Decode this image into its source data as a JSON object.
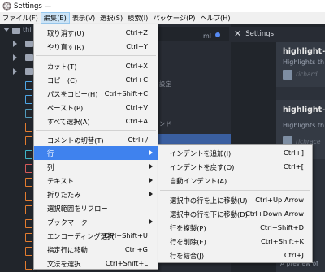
{
  "window": {
    "title": "Settings — "
  },
  "menubar": [
    "ファイル(F)",
    "編集(E)",
    "表示(V)",
    "選択(S)",
    "検索(I)",
    "パッケージ(P)",
    "ヘルプ(H)"
  ],
  "tree": {
    "root_label": "thi"
  },
  "background": {
    "tab_fragment": "ml",
    "settings_tab_label": "Settings",
    "settings_fragment_1": "設定",
    "settings_fragment_2": "ンド",
    "packages": [
      {
        "title": "highlight-",
        "desc": "Highlights th",
        "author": "richard"
      },
      {
        "title": "highlight-se",
        "desc": "Highlights th",
        "author": "richrace"
      }
    ],
    "preview_fragment": "A preview of"
  },
  "edit_menu": {
    "items": [
      {
        "label": "取り消す(U)",
        "shortcut": "Ctrl+Z"
      },
      {
        "label": "やり直す(R)",
        "shortcut": "Ctrl+Y"
      },
      {
        "label": "カット(T)",
        "shortcut": "Ctrl+X"
      },
      {
        "label": "コピー(C)",
        "shortcut": "Ctrl+C"
      },
      {
        "label": "パスをコピー(H)",
        "shortcut": "Ctrl+Shift+C"
      },
      {
        "label": "ペースト(P)",
        "shortcut": "Ctrl+V"
      },
      {
        "label": "すべて選択(A)",
        "shortcut": "Ctrl+A"
      },
      {
        "label": "コメントの切替(T)",
        "shortcut": "Ctrl+/"
      },
      {
        "label": "行",
        "shortcut": ""
      },
      {
        "label": "列",
        "shortcut": ""
      },
      {
        "label": "テキスト",
        "shortcut": ""
      },
      {
        "label": "折りたたみ",
        "shortcut": ""
      },
      {
        "label": "選択範囲をリフロー",
        "shortcut": ""
      },
      {
        "label": "ブックマーク",
        "shortcut": ""
      },
      {
        "label": "エンコーディング選択",
        "shortcut": "Ctrl+Shift+U"
      },
      {
        "label": "指定行に移動",
        "shortcut": "Ctrl+G"
      },
      {
        "label": "文法を選択",
        "shortcut": "Ctrl+Shift+L"
      }
    ]
  },
  "line_menu": {
    "items": [
      {
        "label": "インデントを追加(I)",
        "shortcut": "Ctrl+]"
      },
      {
        "label": "インデントを戻す(O)",
        "shortcut": "Ctrl+["
      },
      {
        "label": "自動インデント(A)",
        "shortcut": ""
      },
      {
        "label": "選択中の行を上に移動(U)",
        "shortcut": "Ctrl+Up Arrow"
      },
      {
        "label": "選択中の行を下に移動(D)",
        "shortcut": "Ctrl+Down Arrow"
      },
      {
        "label": "行を複製(P)",
        "shortcut": "Ctrl+Shift+D"
      },
      {
        "label": "行を削除(E)",
        "shortcut": "Ctrl+Shift+K"
      },
      {
        "label": "行を結合(J)",
        "shortcut": "Ctrl+J"
      }
    ]
  },
  "colors": {
    "highlight": "#3f82ee",
    "menu_bg": "#f2f2f2",
    "editor_bg": "#282c34"
  }
}
